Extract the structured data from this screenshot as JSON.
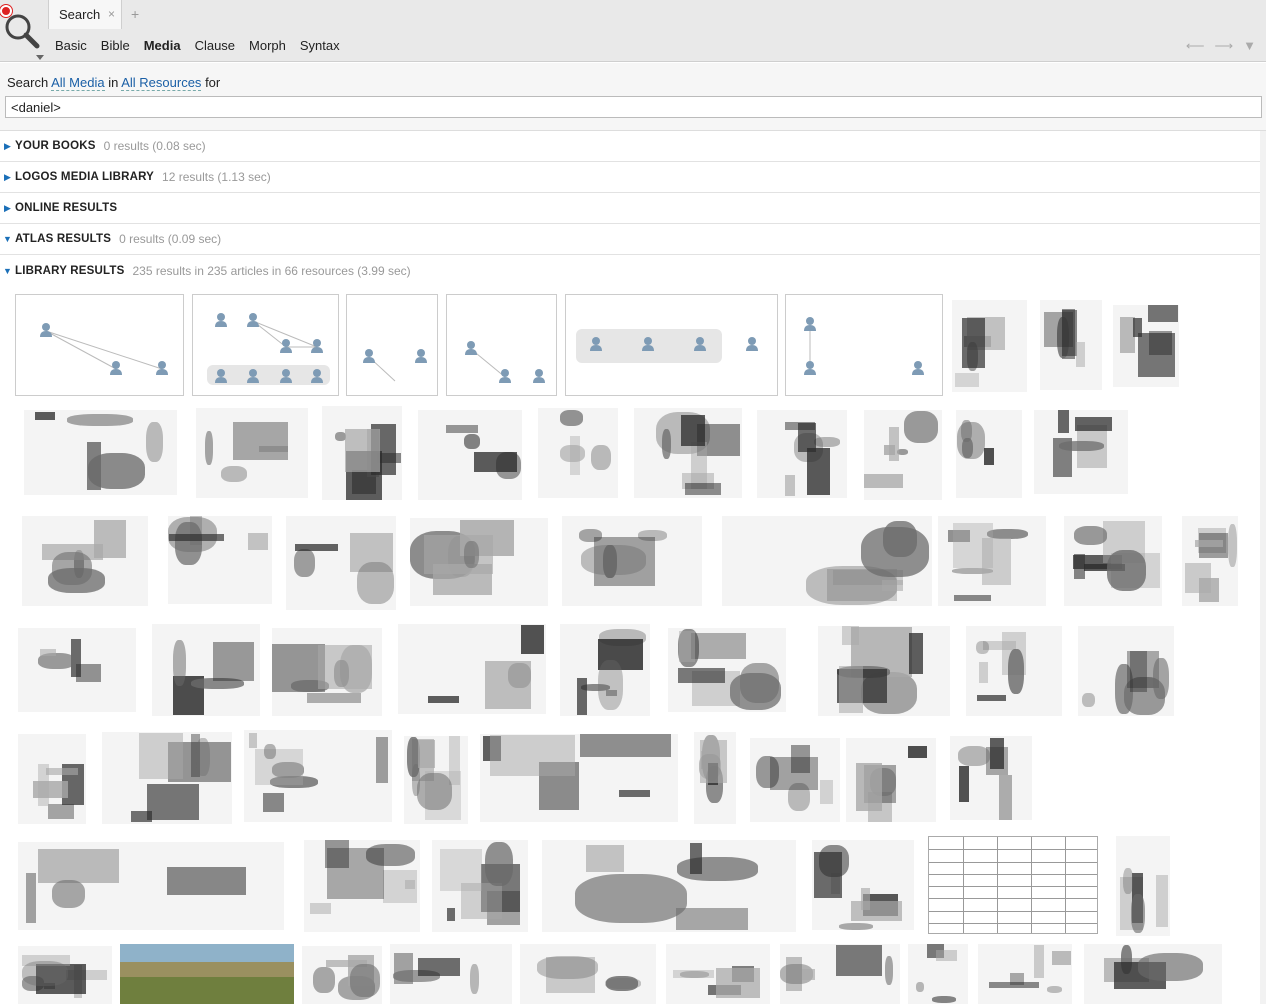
{
  "tab": {
    "title": "Search",
    "close": "×",
    "add": "+"
  },
  "modes": [
    "Basic",
    "Bible",
    "Media",
    "Clause",
    "Morph",
    "Syntax"
  ],
  "active_mode": "Media",
  "nav": {
    "back": "⟵",
    "forward": "⟶",
    "menu": "▼"
  },
  "query": {
    "prefix": "Search",
    "scope_media": "All Media",
    "in_word": "in",
    "scope_resources": "All Resources",
    "suffix": "for",
    "value": "<daniel>"
  },
  "sections": [
    {
      "name": "YOUR BOOKS",
      "count": "0 results (0.08 sec)",
      "expanded": false
    },
    {
      "name": "LOGOS MEDIA LIBRARY",
      "count": "12 results (1.13 sec)",
      "expanded": false
    },
    {
      "name": "ONLINE RESULTS",
      "count": "",
      "expanded": false
    },
    {
      "name": "ATLAS RESULTS",
      "count": "0 results (0.09 sec)",
      "expanded": true
    },
    {
      "name": "LIBRARY RESULTS",
      "count": "235 results in 235 articles in 66 resources (3.99 sec)",
      "expanded": true
    }
  ],
  "colors": {
    "link": "#1a5fa6",
    "expander": "#1a6fb8",
    "dim_text": "#999999",
    "logo_red": "#dd2222"
  }
}
